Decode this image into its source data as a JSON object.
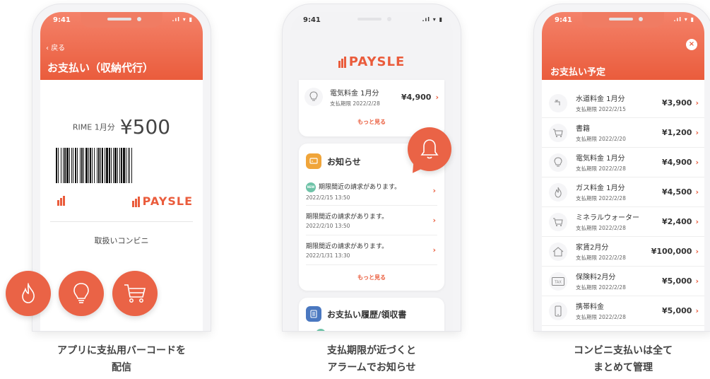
{
  "colors": {
    "accent": "#ea5c3c",
    "new_badge": "#6fc3a8",
    "notice_icon": "#f0a53a",
    "history_icon": "#4a78c0"
  },
  "phone1": {
    "time": "9:41",
    "back": "戻る",
    "title": "お支払い（収納代行）",
    "amount_label": "RIME  1月分",
    "amount": "¥500",
    "logo": "PAYSLE",
    "store_label": "取扱いコンビニ"
  },
  "feature_icons": [
    "flame-icon",
    "lightbulb-icon",
    "cart-icon"
  ],
  "phone2": {
    "time": "9:41",
    "logo": "PAYSLE",
    "bill": {
      "name": "電気料金 1月分",
      "due": "支払期限 2022/2/28",
      "amount": "¥4,900"
    },
    "more1": "もっと見る",
    "notices_title": "お知らせ",
    "new_badge": "NEW",
    "notices": [
      {
        "text": "期限間近の請求があります。",
        "date": "2022/2/15 13:50"
      },
      {
        "text": "期限間近の請求があります。",
        "date": "2022/2/10 13:50"
      },
      {
        "text": "期限間近の請求があります。",
        "date": "2022/1/31 13:30"
      }
    ],
    "more2": "もっと見る",
    "history_title": "お支払い履歴/領収書"
  },
  "phone3": {
    "time": "9:41",
    "title": "お支払い予定",
    "close": "×",
    "items": [
      {
        "name": "水道料金 1月分",
        "due": "支払期限 2022/2/15",
        "amount": "¥3,900",
        "icon": "faucet-icon"
      },
      {
        "name": "書籍",
        "due": "支払期限 2022/2/20",
        "amount": "¥1,200",
        "icon": "cart-icon"
      },
      {
        "name": "電気料金 1月分",
        "due": "支払期限 2022/2/28",
        "amount": "¥4,900",
        "icon": "lightbulb-icon"
      },
      {
        "name": "ガス料金 1月分",
        "due": "支払期限 2022/2/28",
        "amount": "¥4,500",
        "icon": "flame-icon"
      },
      {
        "name": "ミネラルウォーター",
        "due": "支払期限 2022/2/28",
        "amount": "¥2,400",
        "icon": "cart-icon"
      },
      {
        "name": "家賃2月分",
        "due": "支払期限 2022/2/28",
        "amount": "¥100,000",
        "icon": "house-icon"
      },
      {
        "name": "保険料2月分",
        "due": "支払期限 2022/2/28",
        "amount": "¥5,000",
        "icon": "tax-icon"
      },
      {
        "name": "携帯料金",
        "due": "支払期限 2022/2/28",
        "amount": "¥5,000",
        "icon": "phone-icon"
      }
    ]
  },
  "captions": [
    [
      "アプリに支払用バーコードを",
      "配信"
    ],
    [
      "支払期限が近づくと",
      "アラームでお知らせ"
    ],
    [
      "コンビニ支払いは全て",
      "まとめて管理"
    ]
  ]
}
